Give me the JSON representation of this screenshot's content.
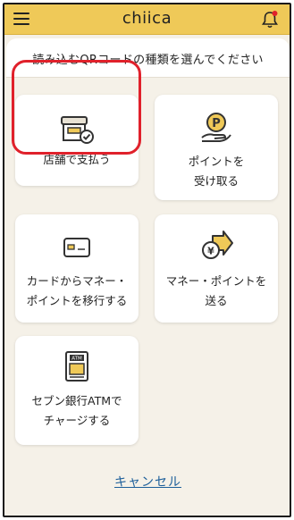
{
  "topbar": {
    "logo_text": "chiica",
    "menu_icon": "hamburger-menu-icon",
    "bell_icon": "bell-icon",
    "notification_dot_color": "#e0212b",
    "background_color": "#efc958"
  },
  "dialog": {
    "title": "読み込むQRコードの種類を選んでください",
    "options": [
      {
        "icon": "store-icon",
        "label": "店舗で支払う",
        "selected": true
      },
      {
        "icon": "points-hand-icon",
        "label": "ポイントを\n受け取る",
        "selected": false
      },
      {
        "icon": "card-icon",
        "label": "カードからマネー・\nポイントを移行する",
        "selected": false
      },
      {
        "icon": "send-points-icon",
        "label": "マネー・ポイントを\n送る",
        "selected": false
      },
      {
        "icon": "atm-icon",
        "label": "セブン銀行ATMで\nチャージする",
        "selected": false
      }
    ],
    "cancel_label": "キャンセル",
    "highlight_color": "#e0212b",
    "link_color": "#1d5f9a"
  }
}
